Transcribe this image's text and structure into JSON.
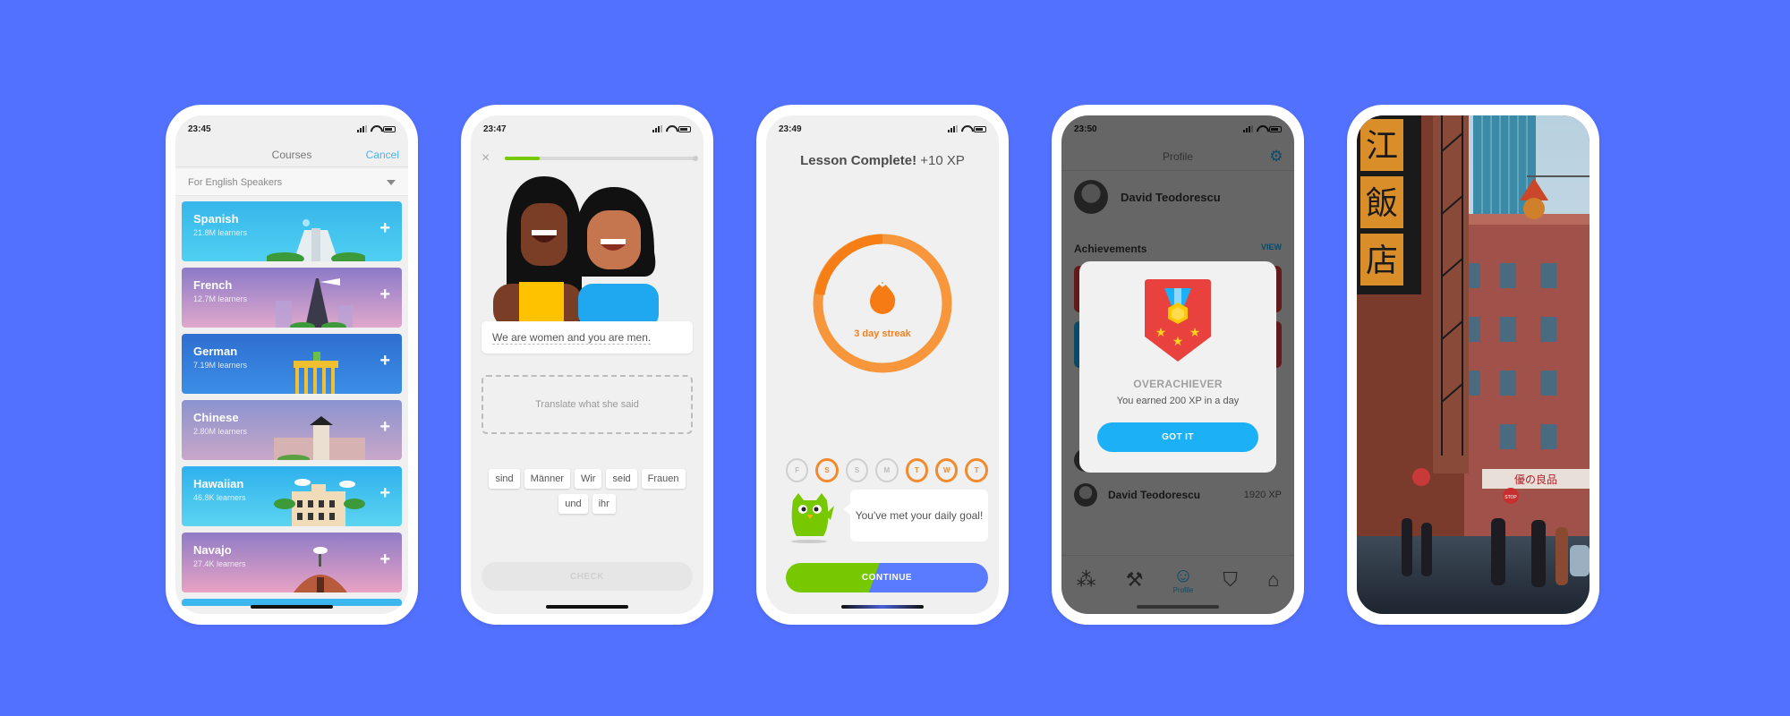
{
  "colors": {
    "background": "#5271ff",
    "duo_green": "#78c800",
    "duo_blue": "#1cb0f6",
    "streak_orange": "#f28a2e",
    "medal_red": "#e8413e"
  },
  "phones": [
    {
      "screen": "courses",
      "status": {
        "time": "23:45"
      },
      "navbar": {
        "title": "Courses",
        "cancel_label": "Cancel"
      },
      "language_filter": {
        "selected": "For English Speakers"
      },
      "courses": [
        {
          "name": "Spanish",
          "learners": "21.8M learners",
          "action": "+"
        },
        {
          "name": "French",
          "learners": "12.7M learners",
          "action": "+"
        },
        {
          "name": "German",
          "learners": "7.19M learners",
          "action": "+"
        },
        {
          "name": "Chinese",
          "learners": "2.80M learners",
          "action": "+"
        },
        {
          "name": "Hawaiian",
          "learners": "46.8K learners",
          "action": "+"
        },
        {
          "name": "Navajo",
          "learners": "27.4K learners",
          "action": "+"
        }
      ]
    },
    {
      "screen": "lesson",
      "status": {
        "time": "23:47"
      },
      "close_icon": "×",
      "progress_fraction": 0.18,
      "prompt_sentence": "We are women and you are men.",
      "answer_placeholder": "Translate what she said",
      "word_bank": [
        "sind",
        "Männer",
        "Wir",
        "seid",
        "Frauen",
        "und",
        "ihr"
      ],
      "check_label": "CHECK"
    },
    {
      "screen": "lesson-complete",
      "status": {
        "time": "23:49"
      },
      "title": "Lesson Complete!",
      "xp_gain": "+10 XP",
      "streak_label": "3 day streak",
      "streak_days": [
        {
          "label": "F",
          "active": false
        },
        {
          "label": "S",
          "active": true
        },
        {
          "label": "S",
          "active": false
        },
        {
          "label": "M",
          "active": false
        },
        {
          "label": "T",
          "active": true
        },
        {
          "label": "W",
          "active": true
        },
        {
          "label": "T",
          "active": true
        }
      ],
      "goal_message": "You've met your daily goal!",
      "continue_label": "CONTINUE"
    },
    {
      "screen": "profile",
      "status": {
        "time": "23:50"
      },
      "navbar": {
        "title": "Profile"
      },
      "user_name": "David Teodorescu",
      "achievements_header": "Achievements",
      "view_label": "VIEW",
      "leaderboard": [
        {
          "name": "David Teodorescu",
          "xp": "1920 XP"
        }
      ],
      "tabs": [
        {
          "name": "learn",
          "glyph": "⁂",
          "label": ""
        },
        {
          "name": "practice",
          "glyph": "⚒",
          "label": ""
        },
        {
          "name": "profile",
          "glyph": "☺",
          "label": "Profile",
          "active": true
        },
        {
          "name": "leagues",
          "glyph": "⛉",
          "label": ""
        },
        {
          "name": "shop",
          "glyph": "⌂",
          "label": ""
        }
      ],
      "modal": {
        "title": "OVERACHIEVER",
        "description": "You earned 200 XP in a day",
        "button_label": "GOT IT"
      }
    },
    {
      "screen": "photo",
      "sign_characters": [
        "江",
        "飯",
        "店"
      ],
      "storefront_sign": "優の良品",
      "stop_sign": "STOP"
    }
  ]
}
